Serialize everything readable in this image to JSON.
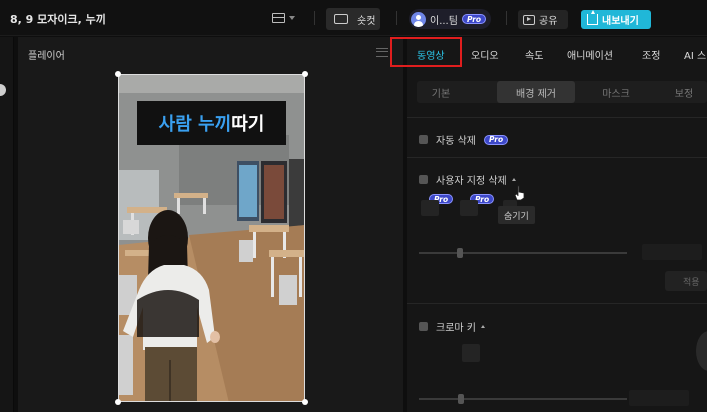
{
  "window": {
    "title": "8, 9 모자이크, 누끼"
  },
  "header": {
    "layout_icon": "layout-icon",
    "shortcut_label": "숏컷",
    "user_name": "이...팀",
    "pro_label": "Pro",
    "share_label": "공유",
    "export_label": "내보내기",
    "export_color": "#20b7d8"
  },
  "player": {
    "label": "플레이어",
    "caption_part1": "사람 누끼",
    "caption_part2": " 따기"
  },
  "right_panel": {
    "tabs": [
      {
        "label": "동영상",
        "active": true
      },
      {
        "label": "오디오"
      },
      {
        "label": "속도"
      },
      {
        "label": "애니메이션"
      },
      {
        "label": "조정"
      },
      {
        "label": "AI 스"
      }
    ],
    "subtabs": [
      {
        "label": "기본"
      },
      {
        "label": "배경 제거",
        "active": true
      },
      {
        "label": "마스크"
      },
      {
        "label": "보정"
      }
    ],
    "auto_remove_label": "자동 삭제",
    "custom_remove_label": "사용자 지정 삭제",
    "tooltip": "숨기기",
    "apply_label": "적용",
    "chroma_key_label": "크로마 키",
    "pro_label": "Pro",
    "accent_color": "#2bc3e6",
    "highlight_color": "#e01e1e"
  }
}
